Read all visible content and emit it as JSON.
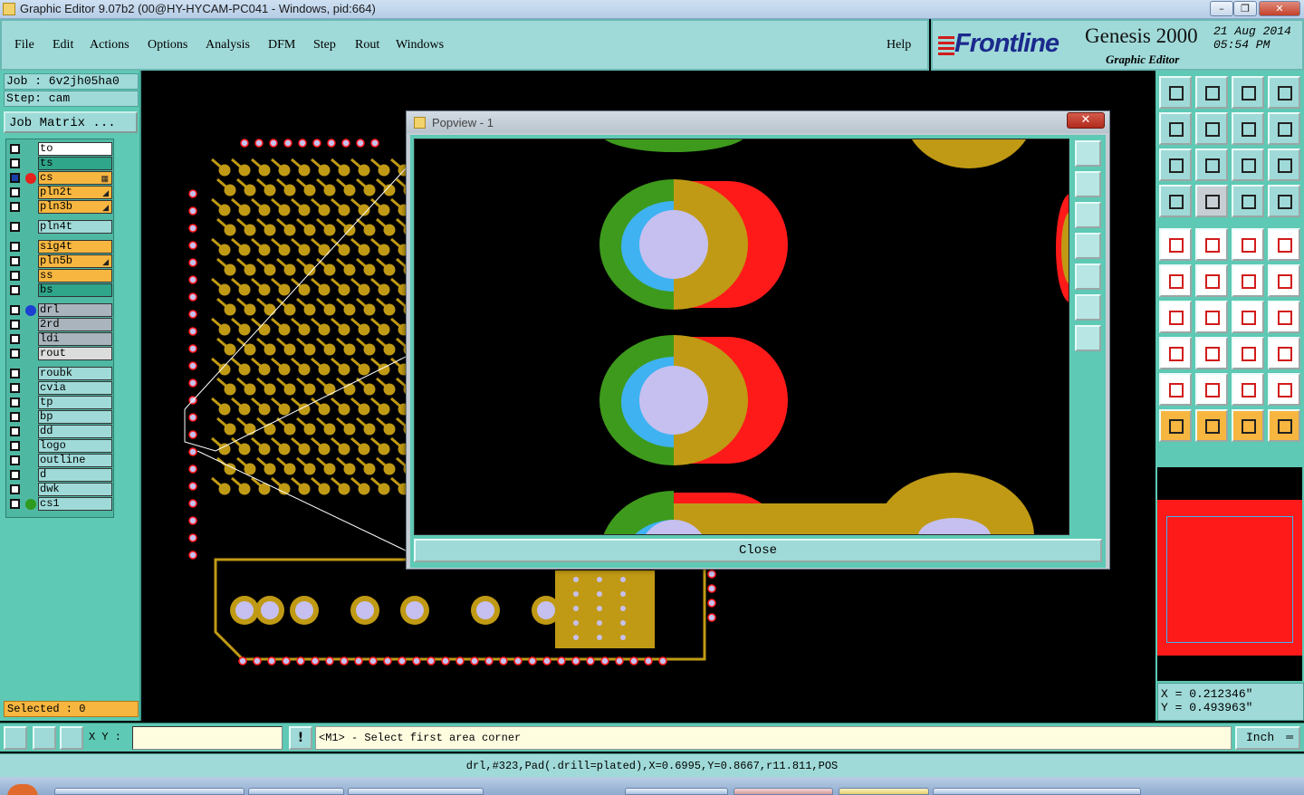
{
  "window": {
    "title": "Graphic Editor 9.07b2 (00@HY-HYCAM-PC041 - Windows, pid:664)"
  },
  "menus": [
    "File",
    "Edit",
    "Actions",
    "Options",
    "Analysis",
    "DFM",
    "Step",
    "Rout",
    "Windows"
  ],
  "help_label": "Help",
  "brand": {
    "logo": "Frontline",
    "product": "Genesis 2000",
    "subtitle": "Graphic Editor",
    "date": "21 Aug 2014",
    "time": "05:54 PM"
  },
  "job": {
    "job_line": "Job : 6v2jh05ha0",
    "step_line": "Step: cam",
    "matrix_label": "Job Matrix ..."
  },
  "layers": [
    {
      "name": "to",
      "color": "#ffffff",
      "dot": "",
      "mark": ""
    },
    {
      "name": "ts",
      "color": "#2fa58a",
      "dot": "",
      "mark": ""
    },
    {
      "name": "cs",
      "color": "#f6b640",
      "dot": "#e5221c",
      "mark": "▦",
      "active": true
    },
    {
      "name": "pln2t",
      "color": "#f6b640",
      "dot": "",
      "mark": "◢"
    },
    {
      "name": "pln3b",
      "color": "#f6b640",
      "dot": "",
      "mark": "◢"
    },
    {
      "name": "pln4t",
      "color": "#9fdad8",
      "dot": "",
      "mark": ""
    },
    {
      "name": "sig4t",
      "color": "#f6b640",
      "dot": "",
      "mark": ""
    },
    {
      "name": "pln5b",
      "color": "#f6b640",
      "dot": "",
      "mark": "◢"
    },
    {
      "name": "ss",
      "color": "#f6b640",
      "dot": "",
      "mark": ""
    },
    {
      "name": "bs",
      "color": "#2fa58a",
      "dot": "",
      "mark": ""
    },
    {
      "name": "drl",
      "color": "#a9b4bd",
      "dot": "#1d3fd1",
      "mark": ""
    },
    {
      "name": "2rd",
      "color": "#a9b4bd",
      "dot": "",
      "mark": ""
    },
    {
      "name": "ldi",
      "color": "#a9b4bd",
      "dot": "",
      "mark": ""
    },
    {
      "name": "rout",
      "color": "#dcdcdc",
      "dot": "",
      "mark": ""
    },
    {
      "name": "roubk",
      "color": "#9fdad8",
      "dot": "",
      "mark": ""
    },
    {
      "name": "cvia",
      "color": "#9fdad8",
      "dot": "",
      "mark": ""
    },
    {
      "name": "tp",
      "color": "#9fdad8",
      "dot": "",
      "mark": ""
    },
    {
      "name": "bp",
      "color": "#9fdad8",
      "dot": "",
      "mark": ""
    },
    {
      "name": "dd",
      "color": "#9fdad8",
      "dot": "",
      "mark": ""
    },
    {
      "name": "logo",
      "color": "#9fdad8",
      "dot": "",
      "mark": ""
    },
    {
      "name": "outline",
      "color": "#9fdad8",
      "dot": "",
      "mark": ""
    },
    {
      "name": "d",
      "color": "#9fdad8",
      "dot": "",
      "mark": ""
    },
    {
      "name": "dwk",
      "color": "#9fdad8",
      "dot": "",
      "mark": ""
    },
    {
      "name": "cs1",
      "color": "#9fdad8",
      "dot": "#2e9a1e",
      "mark": ""
    }
  ],
  "selected": "Selected : 0",
  "popup": {
    "title": "Popview - 1",
    "close_label": "Close"
  },
  "coords": {
    "x": "X = 0.212346\"",
    "y": "Y = 0.493963\""
  },
  "bottom": {
    "xy_label": "X Y :",
    "xy_value": "",
    "prompt": "<M1> - Select first area corner",
    "unit": "Inch"
  },
  "status": "drl,#323,Pad(.drill=plated),X=0.6995,Y=0.8667,r11.811,POS",
  "colors": {
    "copper": "#c09a14",
    "panel": "#5ec9b4",
    "light_panel": "#9fdad8",
    "accent_orange": "#f6b640",
    "red": "#ff1a1a",
    "green": "#3e9a1c",
    "blue": "#3fb2f2",
    "lavender": "#c6c0f0"
  }
}
